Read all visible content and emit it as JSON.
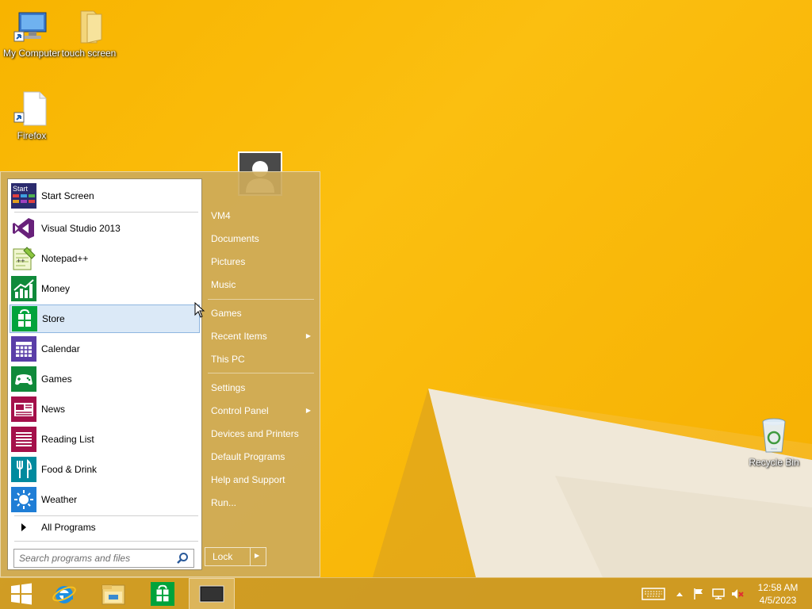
{
  "desktop": {
    "icons": [
      {
        "label": "My Computer"
      },
      {
        "label": "touch screen"
      },
      {
        "label": "Firefox"
      },
      {
        "label": "Recycle Bin"
      }
    ]
  },
  "start_menu": {
    "programs": [
      {
        "label": "Start Screen",
        "icon": "start-screen-icon"
      },
      {
        "label": "Visual Studio 2013",
        "icon": "visual-studio-icon"
      },
      {
        "label": "Notepad++",
        "icon": "notepad-plus-plus-icon"
      },
      {
        "label": "Money",
        "icon": "money-icon"
      },
      {
        "label": "Store",
        "icon": "store-icon"
      },
      {
        "label": "Calendar",
        "icon": "calendar-icon"
      },
      {
        "label": "Games",
        "icon": "games-icon"
      },
      {
        "label": "News",
        "icon": "news-icon"
      },
      {
        "label": "Reading List",
        "icon": "reading-list-icon"
      },
      {
        "label": "Food & Drink",
        "icon": "food-drink-icon"
      },
      {
        "label": "Weather",
        "icon": "weather-icon"
      }
    ],
    "all_programs": "All Programs",
    "start_badge": "Start",
    "search_placeholder": "Search programs and files",
    "right_links": [
      {
        "label": "VM4"
      },
      {
        "label": "Documents"
      },
      {
        "label": "Pictures"
      },
      {
        "label": "Music"
      },
      {
        "label": "Games"
      },
      {
        "label": "Recent Items"
      },
      {
        "label": "This PC"
      },
      {
        "label": "Settings"
      },
      {
        "label": "Control Panel"
      },
      {
        "label": "Devices and Printers"
      },
      {
        "label": "Default Programs"
      },
      {
        "label": "Help and Support"
      },
      {
        "label": "Run..."
      }
    ],
    "lock_label": "Lock"
  },
  "taskbar": {
    "time": "12:58 AM",
    "date": "4/5/2023"
  },
  "colors": {
    "wallpaper": "#f8b400",
    "start_menu_bg": "#cdaa5a",
    "taskbar_bg": "#c89628",
    "hover": "#dbe9f7"
  }
}
